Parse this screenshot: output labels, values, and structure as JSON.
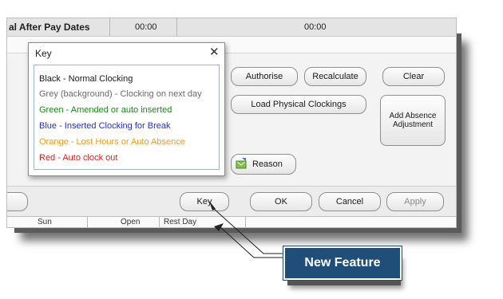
{
  "header": {
    "title": "al After Pay Dates",
    "time1": "00:00",
    "time2": "00:00"
  },
  "key_dialog": {
    "title": "Key",
    "close_icon": "close-icon",
    "lines": [
      {
        "text": "Black - Normal Clocking",
        "color": "#1a1a1a"
      },
      {
        "text": "Grey (background) - Clocking on next day",
        "color": "#6b6b6b"
      },
      {
        "text": "Green - Amended or auto inserted",
        "color": "#1a8a1a"
      },
      {
        "text": "Blue - Inserted Clocking for Break",
        "color": "#2230c8"
      },
      {
        "text": "Orange - Lost Hours or Auto Absence",
        "color": "#f39a21"
      },
      {
        "text": "Red - Auto clock out",
        "color": "#e51c1c"
      }
    ]
  },
  "buttons": {
    "authorise": "Authorise",
    "recalculate": "Recalculate",
    "clear": "Clear",
    "load_physical": "Load Physical Clockings",
    "add_absence": "Add Absence Adjustment",
    "reason": "Reason",
    "key": "Key",
    "ok": "OK",
    "cancel": "Cancel",
    "apply": "Apply"
  },
  "grid_row": {
    "day": "Sun",
    "col2": "Open",
    "col3": "Rest Day"
  },
  "callout": {
    "text": "New Feature",
    "color": "#1f4e78"
  }
}
